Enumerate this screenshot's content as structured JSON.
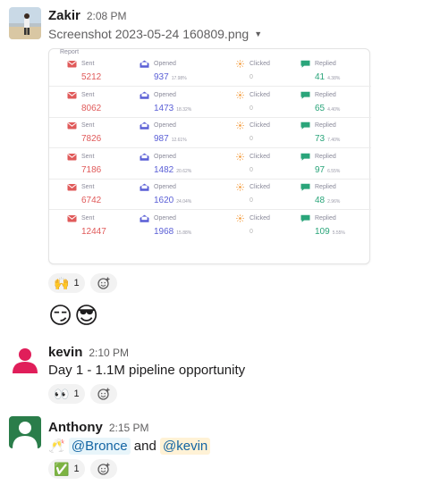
{
  "messages": [
    {
      "author": "Zakir",
      "time": "2:08 PM",
      "file_name": "Screenshot 2023-05-24 160809.png",
      "report": {
        "title": "Report",
        "labels": {
          "sent": "Sent",
          "opened": "Opened",
          "clicked": "Clicked",
          "replied": "Replied"
        },
        "rows": [
          {
            "sent": "5212",
            "opened": "937",
            "opened_pct": "17.98%",
            "clicked": "0",
            "replied": "41",
            "replied_pct": "4.38%"
          },
          {
            "sent": "8062",
            "opened": "1473",
            "opened_pct": "18.32%",
            "clicked": "0",
            "replied": "65",
            "replied_pct": "4.40%"
          },
          {
            "sent": "7826",
            "opened": "987",
            "opened_pct": "12.61%",
            "clicked": "0",
            "replied": "73",
            "replied_pct": "7.40%"
          },
          {
            "sent": "7186",
            "opened": "1482",
            "opened_pct": "20.62%",
            "clicked": "0",
            "replied": "97",
            "replied_pct": "6.55%"
          },
          {
            "sent": "6742",
            "opened": "1620",
            "opened_pct": "24.04%",
            "clicked": "0",
            "replied": "48",
            "replied_pct": "2.96%"
          },
          {
            "sent": "12447",
            "opened": "1968",
            "opened_pct": "15.88%",
            "clicked": "0",
            "replied": "109",
            "replied_pct": "5.55%"
          }
        ]
      },
      "reactions": [
        {
          "emoji": "🙌",
          "count": "1"
        }
      ],
      "followup_emoji": "😏😎"
    },
    {
      "author": "kevin",
      "time": "2:10 PM",
      "text": "Day 1 - 1.1M pipeline opportunity",
      "reactions": [
        {
          "emoji": "👀",
          "count": "1"
        }
      ]
    },
    {
      "author": "Anthony",
      "time": "2:15 PM",
      "prefix_emoji": "🥂",
      "mention_1": "@Bronce",
      "conjunction": "and",
      "mention_2": "@kevin",
      "reactions": [
        {
          "emoji": "✅",
          "count": "1"
        }
      ]
    }
  ],
  "icons": [
    "photo-avatar",
    "person-avatar",
    "sent-mail-icon",
    "opened-mail-icon",
    "clicked-spark-icon",
    "replied-chat-icon",
    "add-reaction-icon",
    "caret-down-icon"
  ],
  "colors": {
    "sent": "#e05a5a",
    "opened": "#5a5fd6",
    "replied": "#2aa57a",
    "kevin_avatar": "#e01e5a",
    "anthony_avatar": "#2a7d4a",
    "mention_bg": "#e8f5fa",
    "mention_text": "#1264a3"
  }
}
